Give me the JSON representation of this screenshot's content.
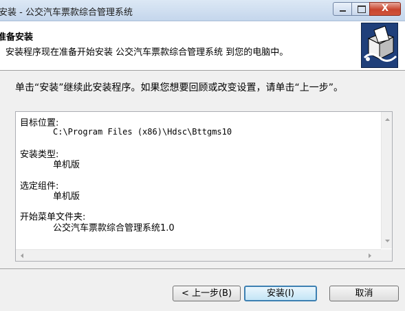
{
  "window": {
    "title": "安装 - 公交汽车票款综合管理系统",
    "close_glyph": "X"
  },
  "header": {
    "title": "准备安装",
    "subtitle": "安装程序现在准备开始安装 公交汽车票款综合管理系统 到您的电脑中。"
  },
  "intro": "单击“安装”继续此安装程序。如果您想要回顾或改变设置，请单击“上一步”。",
  "summary": {
    "dest_label": "目标位置:",
    "dest_value": "C:\\Program Files (x86)\\Hdsc\\Bttgms10",
    "type_label": "安装类型:",
    "type_value": "单机版",
    "components_label": "选定组件:",
    "components_value": "单机版",
    "menu_label": "开始菜单文件夹:",
    "menu_value": "公交汽车票款综合管理系统1.0"
  },
  "buttons": {
    "back": "< 上一步(B)",
    "install": "安装(I)",
    "cancel": "取消"
  }
}
